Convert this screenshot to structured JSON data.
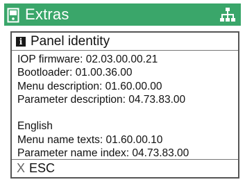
{
  "header": {
    "title": "Extras",
    "left_icon": "panel-icon",
    "right_icon": "menu-tree-icon",
    "accent_color": "#3aa66a"
  },
  "dialog": {
    "icon": "info-icon",
    "icon_glyph": "i",
    "title": "Panel identity",
    "lines": {
      "iop_firmware": "IOP firmware: 02.03.00.00.21",
      "bootloader": "Bootloader: 01.00.36.00",
      "menu_description": "Menu description: 01.60.00.00",
      "parameter_description": "Parameter description: 04.73.83.00",
      "language": "English",
      "menu_name_texts": "Menu name texts: 01.60.00.10",
      "parameter_name_index": "Parameter name index: 04.73.83.00"
    }
  },
  "footer": {
    "esc_key": "X",
    "esc_label": "ESC"
  }
}
